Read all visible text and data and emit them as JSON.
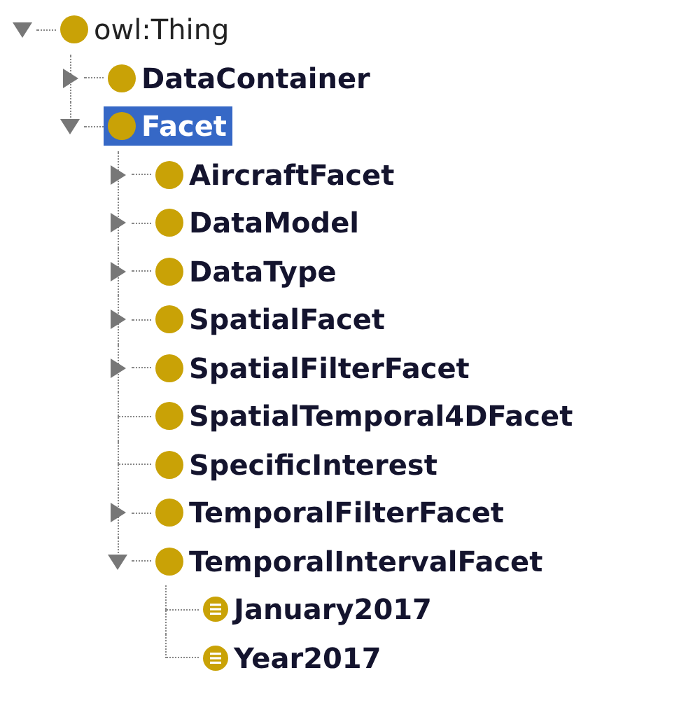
{
  "tree": [
    {
      "label": "owl:Thing",
      "kind": "root",
      "expanded": true,
      "selected": false,
      "children": [
        {
          "label": "DataContainer",
          "kind": "class",
          "expanded": false,
          "selected": false
        },
        {
          "label": "Facet",
          "kind": "class",
          "expanded": true,
          "selected": true,
          "children": [
            {
              "label": "AircraftFacet",
              "kind": "class",
              "expanded": false,
              "selected": false
            },
            {
              "label": "DataModel",
              "kind": "class",
              "expanded": false,
              "selected": false
            },
            {
              "label": "DataType",
              "kind": "class",
              "expanded": false,
              "selected": false
            },
            {
              "label": "SpatialFacet",
              "kind": "class",
              "expanded": false,
              "selected": false
            },
            {
              "label": "SpatialFilterFacet",
              "kind": "class",
              "expanded": false,
              "selected": false
            },
            {
              "label": "SpatialTemporal4DFacet",
              "kind": "class",
              "selected": false
            },
            {
              "label": "SpecificInterest",
              "kind": "class",
              "selected": false
            },
            {
              "label": "TemporalFilterFacet",
              "kind": "class",
              "expanded": false,
              "selected": false
            },
            {
              "label": "TemporalIntervalFacet",
              "kind": "class",
              "expanded": true,
              "selected": false,
              "children": [
                {
                  "label": "January2017",
                  "kind": "individual",
                  "selected": false
                },
                {
                  "label": "Year2017",
                  "kind": "individual",
                  "selected": false
                }
              ]
            }
          ]
        }
      ]
    }
  ]
}
